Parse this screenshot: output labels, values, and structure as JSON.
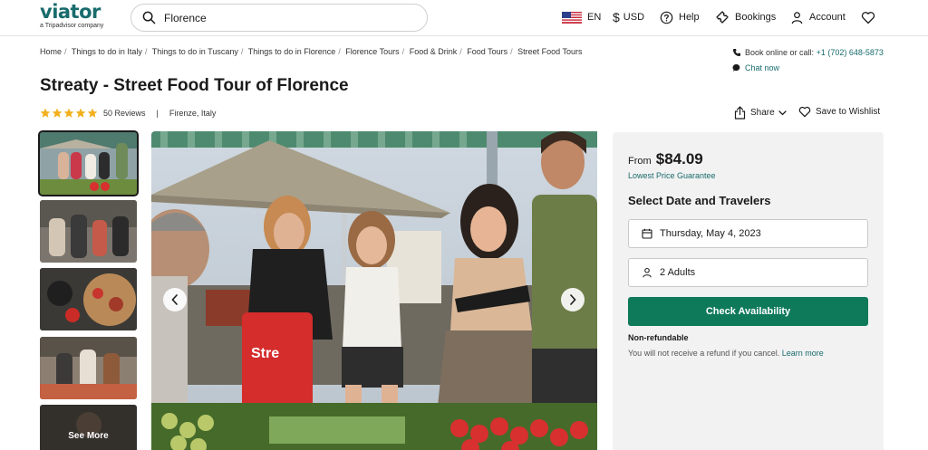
{
  "header": {
    "logo_text": "viator",
    "logo_sub": "a Tripadvisor company",
    "search_value": "Florence",
    "language": "EN",
    "currency": "USD",
    "help": "Help",
    "bookings": "Bookings",
    "account": "Account"
  },
  "breadcrumb": [
    "Home",
    "Things to do in Italy",
    "Things to do in Tuscany",
    "Things to do in Florence",
    "Florence Tours",
    "Food & Drink",
    "Food Tours",
    "Street Food Tours"
  ],
  "contact": {
    "book_prefix": "Book online or call:",
    "phone": "+1 (702) 648-5873",
    "chat": "Chat now"
  },
  "product": {
    "title": "Streaty - Street Food Tour of Florence",
    "reviews": "50 Reviews",
    "rating": 5,
    "location": "Firenze, Italy",
    "share": "Share",
    "wishlist": "Save to Wishlist"
  },
  "gallery": {
    "see_more": "See More"
  },
  "booking": {
    "from_label": "From",
    "price": "$84.09",
    "guarantee": "Lowest Price Guarantee",
    "heading": "Select Date and Travelers",
    "date": "Thursday, May 4, 2023",
    "travelers": "2 Adults",
    "cta": "Check Availability",
    "nonrefundable": "Non-refundable",
    "refund_note": "You will not receive a refund if you cancel.",
    "learn_more": "Learn more"
  },
  "colors": {
    "brand": "#186b6d",
    "cta": "#0e7a5a",
    "star": "#f2b01e"
  }
}
